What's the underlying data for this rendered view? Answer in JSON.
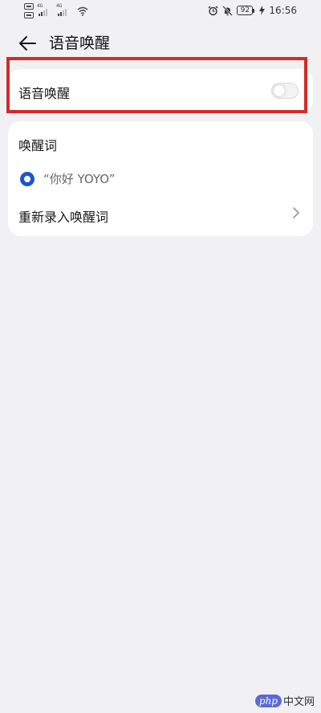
{
  "status_bar": {
    "sim1_tag": "4G",
    "sim2_tag": "4G",
    "battery": "92",
    "time": "16:56",
    "icons": [
      "sim-card-icon",
      "signal-icon",
      "wifi-icon",
      "alarm-icon",
      "mute-bell-icon",
      "battery-icon",
      "charging-icon"
    ]
  },
  "header": {
    "title": "语音唤醒",
    "back_icon": "arrow-left-icon"
  },
  "voice_wakeup": {
    "label": "语音唤醒",
    "enabled": false
  },
  "wake_word": {
    "section_title": "唤醒词",
    "option_label": "“你好 YOYO”",
    "selected": true,
    "rerecord_label": "重新录入唤醒词"
  },
  "watermark": {
    "logo_text": "php",
    "text": "中文网"
  },
  "colors": {
    "accent": "#1e56c9",
    "highlight": "#d42a2a",
    "background": "#f1f1f3"
  }
}
